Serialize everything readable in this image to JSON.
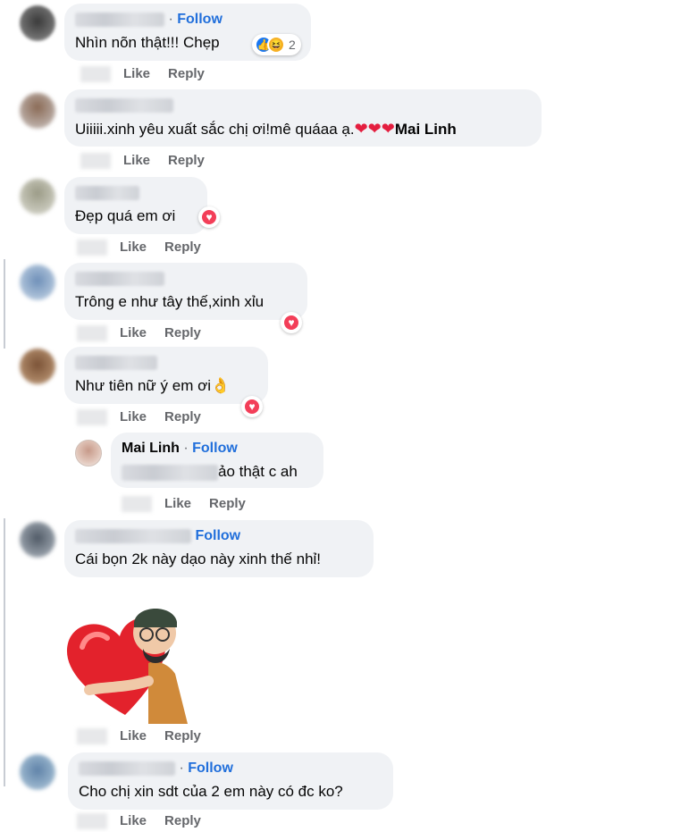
{
  "comments": [
    {
      "follow": "Follow",
      "text": "Nhìn nõn thật!!! Chẹp",
      "reaction_count": "2",
      "like": "Like",
      "reply": "Reply",
      "reactions": [
        "like-icon",
        "haha-icon"
      ]
    },
    {
      "text": "Uiiiii.xinh yêu xuất sắc chị ơi!mê quáaa ạ.",
      "hearts": "❤❤❤",
      "mention": "Mai Linh",
      "like": "Like",
      "reply": "Reply"
    },
    {
      "text": "Đẹp quá em ơi",
      "like": "Like",
      "reply": "Reply",
      "reactions": [
        "love-icon"
      ]
    },
    {
      "text": "Trông e như tây thế,xinh xỉu",
      "like": "Like",
      "reply": "Reply",
      "reactions": [
        "love-icon"
      ]
    },
    {
      "text": "Như tiên nữ ý em ơi",
      "emoji": "👌",
      "like": "Like",
      "reply": "Reply",
      "reactions": [
        "love-icon"
      ]
    },
    {
      "author": "Mai Linh",
      "follow": "Follow",
      "text_visible": "ảo thật c ah",
      "like": "Like",
      "reply": "Reply"
    },
    {
      "follow": "Follow",
      "text": "Cái bọn 2k này dạo này xinh thế nhỉ!",
      "like": "Like",
      "reply": "Reply",
      "sticker": "heart-hug-sticker"
    },
    {
      "follow": "Follow",
      "text": "Cho chị xin sdt của 2 em này có đc ko?",
      "like": "Like",
      "reply": "Reply"
    }
  ],
  "colors": {
    "bubble": "#f0f2f5",
    "follow": "#216fdb",
    "meta": "#65676b",
    "love": "#f33e58",
    "like": "#1877f2"
  }
}
